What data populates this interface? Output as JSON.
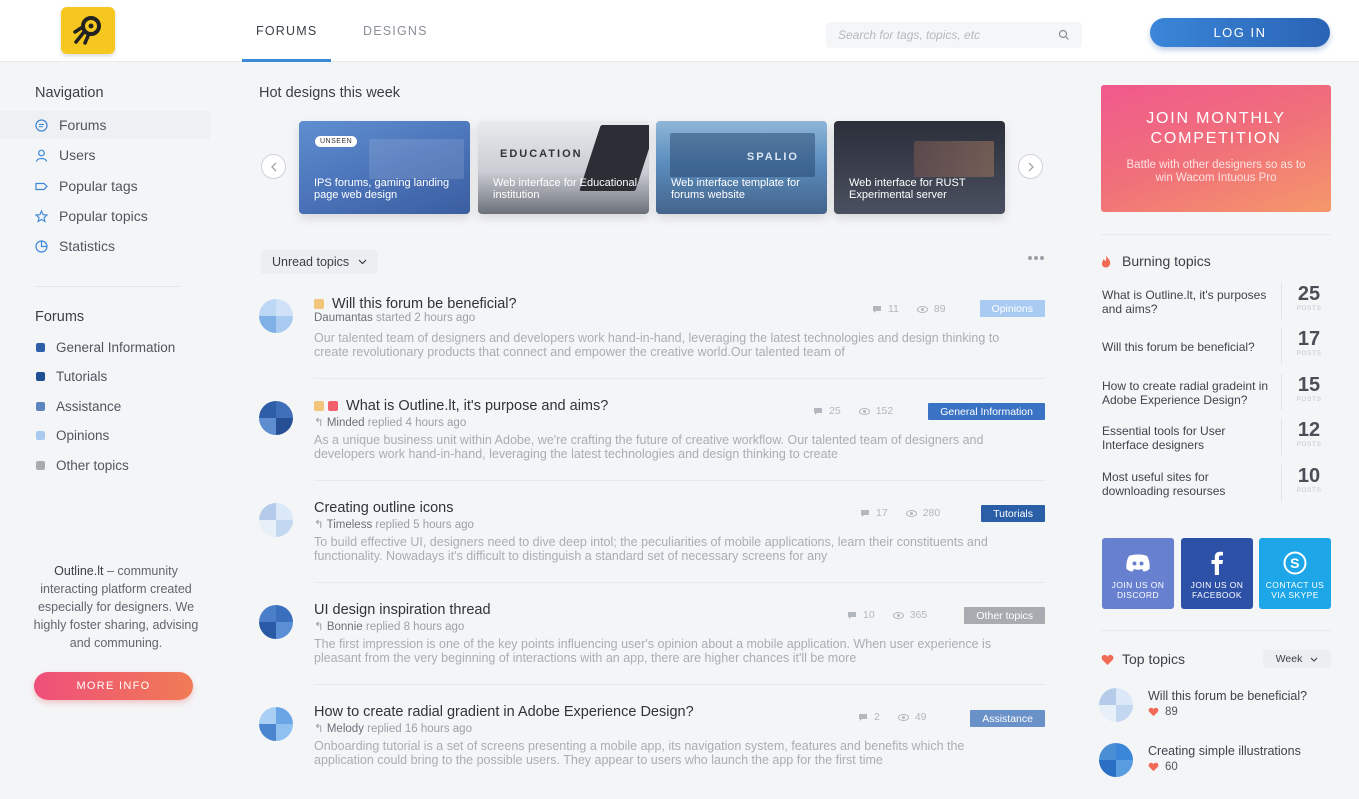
{
  "header": {
    "tabs": [
      {
        "label": "FORUMS",
        "active": true
      },
      {
        "label": "DESIGNS",
        "active": false
      }
    ],
    "search_placeholder": "Search for tags, topics, etc",
    "login_label": "LOG IN"
  },
  "sidebar": {
    "nav_title": "Navigation",
    "nav_items": [
      {
        "label": "Forums",
        "icon": "chat-icon"
      },
      {
        "label": "Users",
        "icon": "user-icon"
      },
      {
        "label": "Popular tags",
        "icon": "tag-icon"
      },
      {
        "label": "Popular topics",
        "icon": "star-icon"
      },
      {
        "label": "Statistics",
        "icon": "pie-chart-icon"
      }
    ],
    "forums_title": "Forums",
    "forums": [
      {
        "label": "General Information",
        "color": "#2f5fa8"
      },
      {
        "label": "Tutorials",
        "color": "#1f4f94"
      },
      {
        "label": "Assistance",
        "color": "#5d86c0"
      },
      {
        "label": "Opinions",
        "color": "#a9cbf2"
      },
      {
        "label": "Other topics",
        "color": "#a8abb0"
      }
    ],
    "about_brand": "Outline.lt",
    "about_text": " – community interacting platform created especially for designers. We highly foster sharing, advising and communing.",
    "more_info_label": "MORE INFO"
  },
  "main": {
    "hot_title": "Hot designs this week",
    "cards": [
      {
        "caption": "IPS forums, gaming landing page web design",
        "tag": "UNSEEN"
      },
      {
        "caption": "Web interface for Educational institution",
        "heading": "EDUCATION"
      },
      {
        "caption": "Web interface template for forums website",
        "heading": "SPALIO"
      },
      {
        "caption": "Web interface for RUST Experimental server"
      }
    ],
    "filter_label": "Unread topics",
    "topics": [
      {
        "title": "Will this forum be beneficial?",
        "author": "Daumantas",
        "action": "started 2 hours ago",
        "replies": "11",
        "views": "89",
        "badge": "Opinions",
        "badge_color": "#a9cbf2",
        "excerpt": "Our talented team of designers and developers work hand-in-hand, leveraging the latest technologies and design thinking to create revolutionary products that connect and empower the creative world.Our talented team of"
      },
      {
        "title": "What is Outline.lt, it's purpose and aims?",
        "author": "Minded",
        "action": "replied 4 hours ago",
        "replies": "25",
        "views": "152",
        "badge": "General Information",
        "badge_color": "#3a72c4",
        "excerpt": "As a unique business unit within Adobe, we're crafting the future of creative workflow. Our talented team of designers and developers work hand-in-hand, leveraging the latest technologies and design thinking to create"
      },
      {
        "title": "Creating outline icons",
        "author": "Timeless",
        "action": "replied 5 hours ago",
        "replies": "17",
        "views": "280",
        "badge": "Tutorials",
        "badge_color": "#2a5fa8",
        "excerpt": "To build effective UI, designers need to dive deep intol; the peculiarities of mobile applications, learn their constituents and functionality. Nowadays it's difficult to distinguish a standard set of necessary screens for any"
      },
      {
        "title": "UI design inspiration thread",
        "author": "Bonnie",
        "action": "replied 8 hours ago",
        "replies": "10",
        "views": "365",
        "badge": "Other topics",
        "badge_color": "#a8abb0",
        "excerpt": "The first impression is one of the key points influencing user's opinion about a mobile application. When user experience is pleasant from the very beginning of interactions with an app, there are higher chances it'll be more"
      },
      {
        "title": "How to create radial gradient in Adobe Experience Design?",
        "author": "Melody",
        "action": "replied 16 hours ago",
        "replies": "2",
        "views": "49",
        "badge": "Assistance",
        "badge_color": "#6a91c8",
        "excerpt": "Onboarding tutorial is a set of screens presenting a mobile app, its navigation system, features and benefits which the application could bring to the possible users. They appear to users who launch the app for the first time"
      }
    ]
  },
  "right": {
    "promo_title": "JOIN MONTHLY COMPETITION",
    "promo_text": "Battle with other designers so as to win Wacom Intuous Pro",
    "burning_title": "Burning topics",
    "posts_label": "POSTS",
    "burning": [
      {
        "title": "What is Outline.lt, it's purposes and aims?",
        "count": "25"
      },
      {
        "title": "Will this forum be beneficial?",
        "count": "17"
      },
      {
        "title": "How to create radial gradeint in Adobe Experience Design?",
        "count": "15"
      },
      {
        "title": "Essential tools for User Interface designers",
        "count": "12"
      },
      {
        "title": "Most useful sites for downloading resourses",
        "count": "10"
      }
    ],
    "social": [
      {
        "label": "JOIN US ON DISCORD",
        "icon": "discord-icon",
        "color": "#6880d0"
      },
      {
        "label": "JOIN US ON FACEBOOK",
        "icon": "facebook-icon",
        "color": "#2e51a8"
      },
      {
        "label": "CONTACT US VIA SKYPE",
        "icon": "skype-icon",
        "color": "#1ea7e8"
      }
    ],
    "top_title": "Top topics",
    "top_period": "Week",
    "top": [
      {
        "title": "Will this forum be beneficial?",
        "likes": "89"
      },
      {
        "title": "Creating simple illustrations",
        "likes": "60"
      }
    ]
  }
}
